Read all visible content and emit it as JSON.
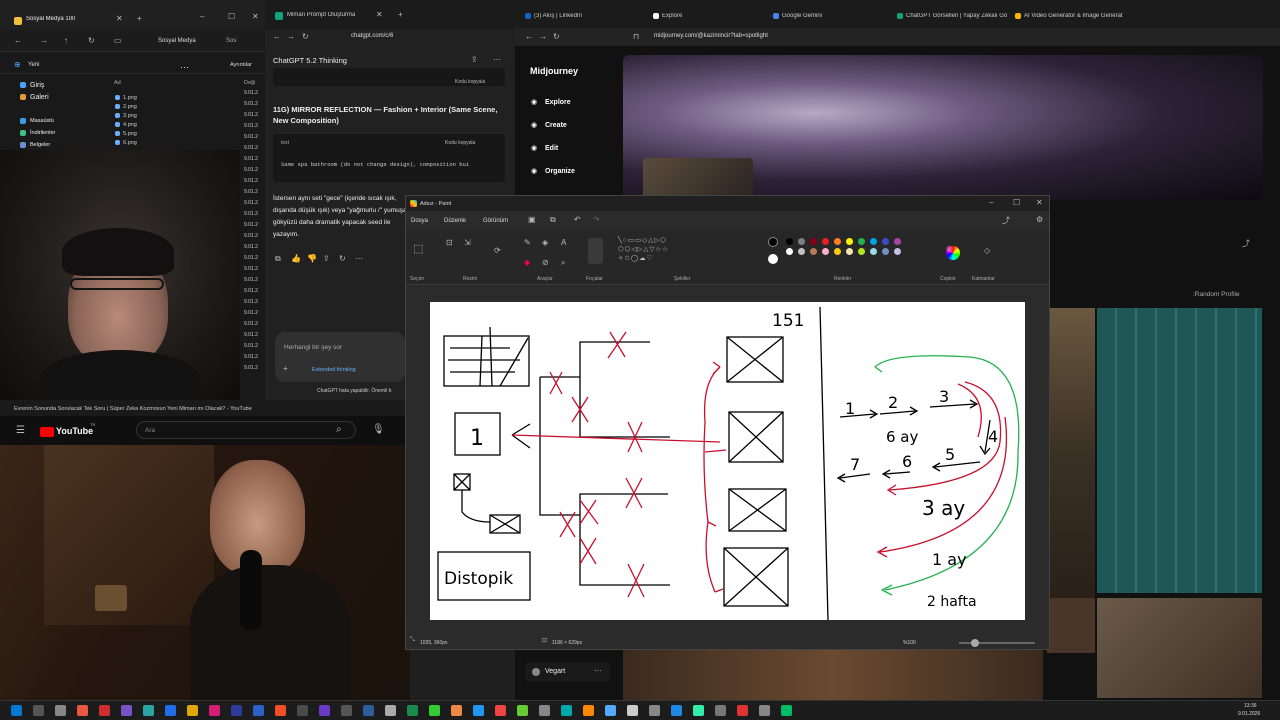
{
  "explorer": {
    "tab_title": "Sosyal Medya 100",
    "path": "Sosyal Medya",
    "search": "Sos",
    "new_label": "Yeni",
    "options_label": "Ayrıntılar",
    "col_name": "Ad",
    "col_date": "Deği",
    "nav_items": [
      "Giriş",
      "Galeri",
      "Masaüstü",
      "İndirilenler",
      "Belgeler"
    ],
    "files": [
      "1.png",
      "2.png",
      "3.png",
      "4.png",
      "5.png",
      "6.png"
    ],
    "dates": [
      "9.01.2",
      "9.01.2",
      "9.01.2",
      "9.01.2",
      "9.01.2",
      "9.01.2",
      "9.01.2",
      "9.01.2",
      "9.01.2",
      "9.01.2",
      "9.01.2",
      "9.01.2",
      "9.01.2",
      "9.01.2",
      "9.01.2",
      "9.01.2",
      "9.01.2",
      "9.01.2",
      "9.01.2",
      "9.01.2",
      "9.01.2",
      "9.01.2",
      "9.01.2",
      "9.01.2",
      "9.01.2",
      "9.01.2"
    ]
  },
  "chatgpt": {
    "tab_title": "Mimari Prompt Oluşturma",
    "url": "chatgpt.com/c/6",
    "model": "ChatGPT 5.2 Thinking",
    "copy_label": "Kodu kopyala",
    "heading": "11G) MIRROR REFLECTION — Fashion + Interior (Same Scene, New Composition)",
    "code_lang": "text",
    "code_text": "Same spa bathroom (do not change design), composition bui",
    "para": "İstersen aynı seti \"gece\" (içeride sıcak ışık, dışarıda düşük ışık) veya \"yağmurlu /\" yumuşak gökyüzü daha dramatik yapacak seed ile yazayım.",
    "input_placeholder": "Herhangi bir şey sor",
    "extended": "Extended thinking",
    "footer": "ChatGPT hata yapabilir. Önemli b"
  },
  "midjourney": {
    "tabs": [
      "(3) Akış | LinkedIn",
      "Explore",
      "Google Gemini",
      "ChatGPT Görselleri | Yapay Zekalı Gö",
      "AI Video Generator & Image Generat"
    ],
    "url": "midjourney.com/@kazimincir?tab=spotlight",
    "logo": "Midjourney",
    "nav": [
      "Explore",
      "Create",
      "Edit",
      "Organize"
    ],
    "profile_link": ":Random Profile",
    "user": "Vegart"
  },
  "youtube": {
    "tab_title": "Evrenin Sonunda Sorulacak Tek Soru | Süper Zeka Kozmosun Yeni Mimarı mı Olacak? - YouTube",
    "logo": "YouTube",
    "region": "TR",
    "search_placeholder": "Ara"
  },
  "paint": {
    "title": "Adsız - Paint",
    "menus": [
      "Dosya",
      "Düzenle",
      "Görünüm"
    ],
    "groups": [
      "Seçim",
      "Resim",
      "Araçlar",
      "Fırçalar",
      "Şekiller",
      "Renkler",
      "Copilot",
      "Katmanlar"
    ],
    "colors": [
      "#000000",
      "#7f7f7f",
      "#880015",
      "#ed1c24",
      "#ff7f27",
      "#fff200",
      "#22b14c",
      "#00a2e8",
      "#3f48cc",
      "#a349a4",
      "#ffffff",
      "#c3c3c3",
      "#b97a57",
      "#ffaec9",
      "#ffc90e",
      "#efe4b0",
      "#b5e61d",
      "#99d9ea",
      "#7092be",
      "#c8bfe7"
    ],
    "status_pos": "1035, 360px",
    "status_size": "1186 × 629px",
    "zoom": "%100"
  },
  "sketch": {
    "number_top": "151",
    "box_label": "1",
    "box_bottom": "Distopik",
    "steps": [
      "1",
      "2",
      "3",
      "4",
      "5",
      "6",
      "7"
    ],
    "label_6ay": "6 ay",
    "label_3ay": "3 ay",
    "label_1ay": "1 ay",
    "label_2hafta": "2 hafta"
  },
  "clock": {
    "time": "13:36",
    "date": "9.01.2026"
  },
  "colors": {
    "red": "#c8102e",
    "green": "#22b14c",
    "paint_bg": "#2b2b2b"
  }
}
